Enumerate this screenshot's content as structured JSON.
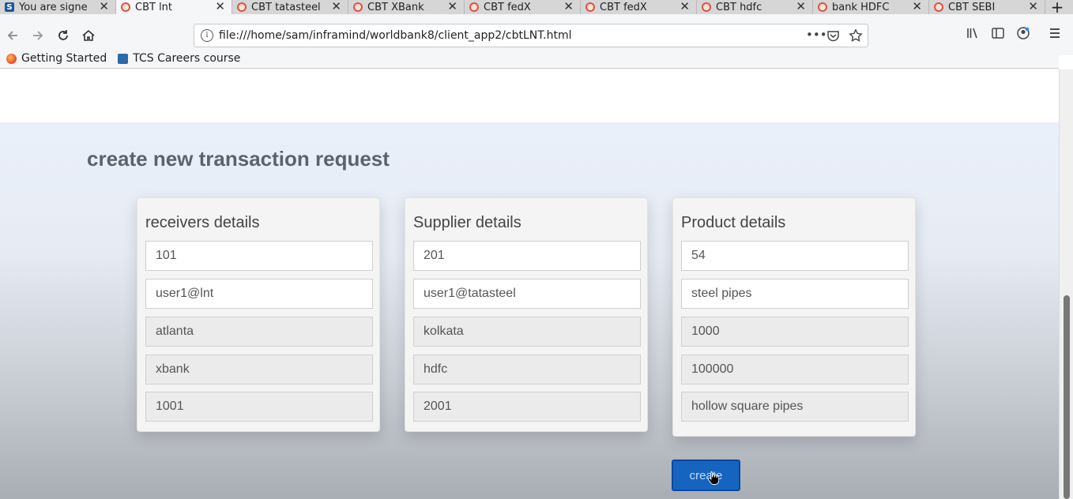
{
  "browser": {
    "tabs": [
      {
        "title": "You are signe",
        "favicon": "sap-icon",
        "active": false
      },
      {
        "title": "CBT lnt",
        "favicon": "page-icon",
        "active": true
      },
      {
        "title": "CBT tatasteel",
        "favicon": "page-icon",
        "active": false
      },
      {
        "title": "CBT XBank",
        "favicon": "page-icon",
        "active": false
      },
      {
        "title": "CBT fedX",
        "favicon": "page-icon",
        "active": false
      },
      {
        "title": "CBT fedX",
        "favicon": "page-icon",
        "active": false
      },
      {
        "title": "CBT hdfc",
        "favicon": "page-icon",
        "active": false
      },
      {
        "title": "bank HDFC",
        "favicon": "page-icon",
        "active": false
      },
      {
        "title": "CBT SEBI",
        "favicon": "page-icon",
        "active": false
      }
    ],
    "sap_glyph": "S",
    "close_glyph": "✕",
    "new_tab_glyph": "+",
    "url": "file:///home/sam/inframind/worldbank8/client_app2/cbtLNT.html",
    "info_glyph": "i",
    "bookmarks": [
      {
        "label": "Getting Started",
        "icon": "firefox-icon"
      },
      {
        "label": "TCS Careers course",
        "icon": "tcs-icon"
      }
    ]
  },
  "page": {
    "title": "create new transaction request",
    "cards": [
      {
        "heading": "receivers details",
        "fields": [
          {
            "value": "101",
            "readonly": false
          },
          {
            "value": "user1@lnt",
            "readonly": false
          },
          {
            "value": "atlanta",
            "readonly": true
          },
          {
            "value": "xbank",
            "readonly": true
          },
          {
            "value": "1001",
            "readonly": true
          }
        ]
      },
      {
        "heading": "Supplier details",
        "fields": [
          {
            "value": "201",
            "readonly": false
          },
          {
            "value": "user1@tatasteel",
            "readonly": false
          },
          {
            "value": "kolkata",
            "readonly": true
          },
          {
            "value": "hdfc",
            "readonly": true
          },
          {
            "value": "2001",
            "readonly": true
          }
        ]
      },
      {
        "heading": "Product details",
        "fields": [
          {
            "value": "54",
            "readonly": false
          },
          {
            "value": "steel pipes",
            "readonly": false
          },
          {
            "value": "1000",
            "readonly": true
          },
          {
            "value": "100000",
            "readonly": true
          },
          {
            "value": "hollow square pipes",
            "readonly": true
          }
        ]
      }
    ],
    "create_label": "create"
  },
  "colors": {
    "accent": "#1565c0",
    "tab_favicon": "#e2513b"
  }
}
